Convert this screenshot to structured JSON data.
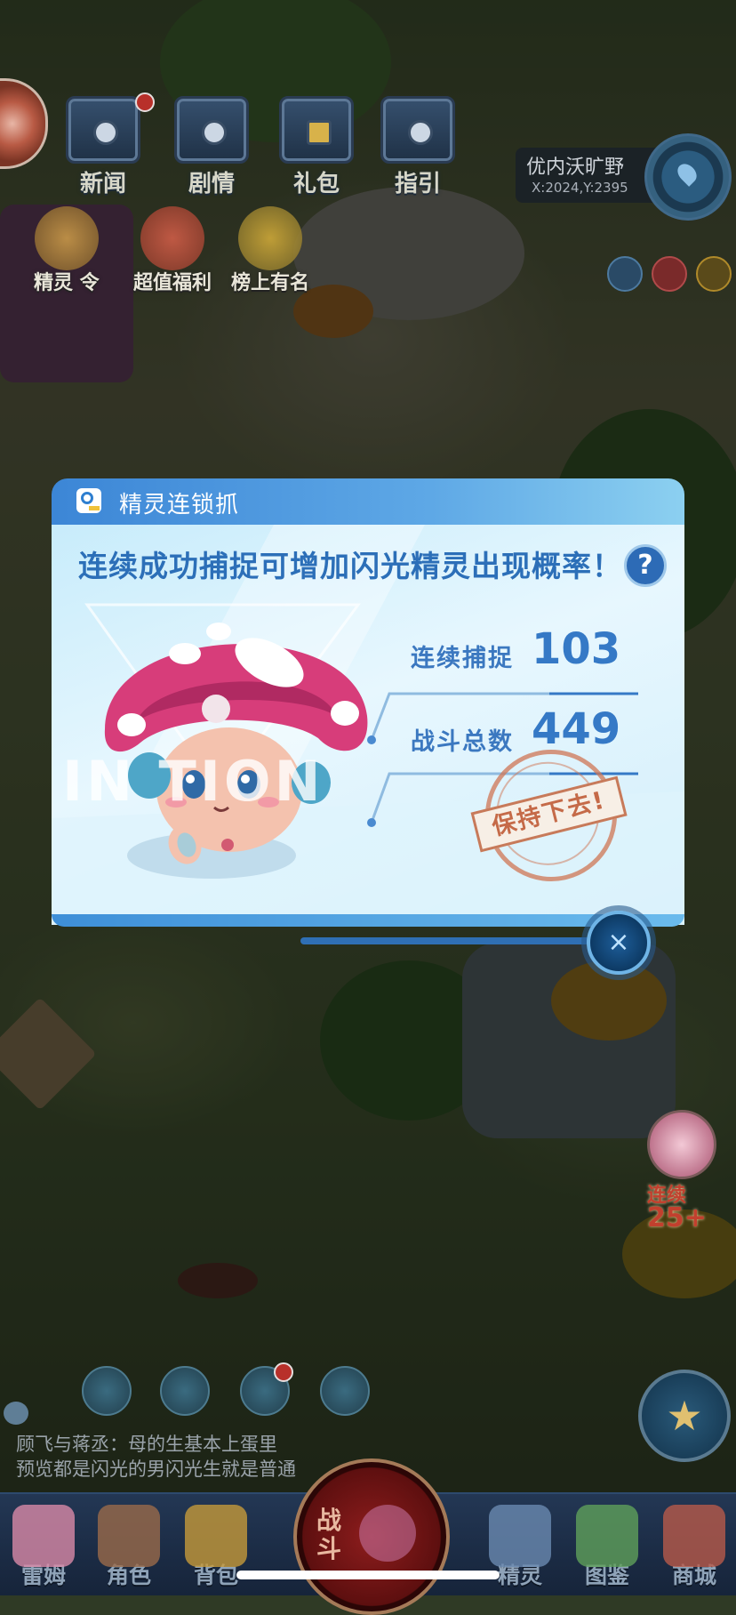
{
  "top_menu": [
    {
      "label": "新闻",
      "icon": "news-chest-icon",
      "badge": true
    },
    {
      "label": "剧情",
      "icon": "story-chest-icon",
      "badge": false
    },
    {
      "label": "礼包",
      "icon": "gift-chest-icon",
      "badge": false
    },
    {
      "label": "指引",
      "icon": "guide-chest-icon",
      "badge": false
    }
  ],
  "event_icons": [
    {
      "label": "精灵 令",
      "icon": "spirit-pass-icon"
    },
    {
      "label": "超值福利",
      "icon": "welfare-gift-icon"
    },
    {
      "label": "榜上有名",
      "icon": "trophy-icon"
    }
  ],
  "location": {
    "name": "优内沃旷野",
    "coords": "X:2024,Y:2395"
  },
  "dialog": {
    "title": "精灵连锁抓",
    "headline": "连续成功捕捉可增加闪光精灵出现概率！",
    "help": "?",
    "watermark": "IN          TION",
    "stats": [
      {
        "label": "连续捕捉",
        "value": "103"
      },
      {
        "label": "战斗总数",
        "value": "449"
      }
    ],
    "stamp": "保持下去!",
    "close": "×"
  },
  "streak_badge": {
    "label": "连续",
    "count": "25+"
  },
  "chat": {
    "line1": "顾飞与蒋丞：母的生基本上蛋里",
    "line2": "预览都是闪光的男闪光生就是普通"
  },
  "dock": [
    {
      "label": "雷姆",
      "color": "#d98aa8"
    },
    {
      "label": "角色",
      "color": "#9a6a4a"
    },
    {
      "label": "背包",
      "color": "#c59a3a"
    },
    {
      "label": "精灵",
      "color": "#6a8ab0"
    },
    {
      "label": "图鉴",
      "color": "#5fa05a"
    },
    {
      "label": "商城",
      "color": "#b85a4a"
    }
  ],
  "battle_label": "战斗",
  "colors": {
    "accent": "#3579c6",
    "header": "#3c86d6",
    "stamp": "#c56a48"
  }
}
